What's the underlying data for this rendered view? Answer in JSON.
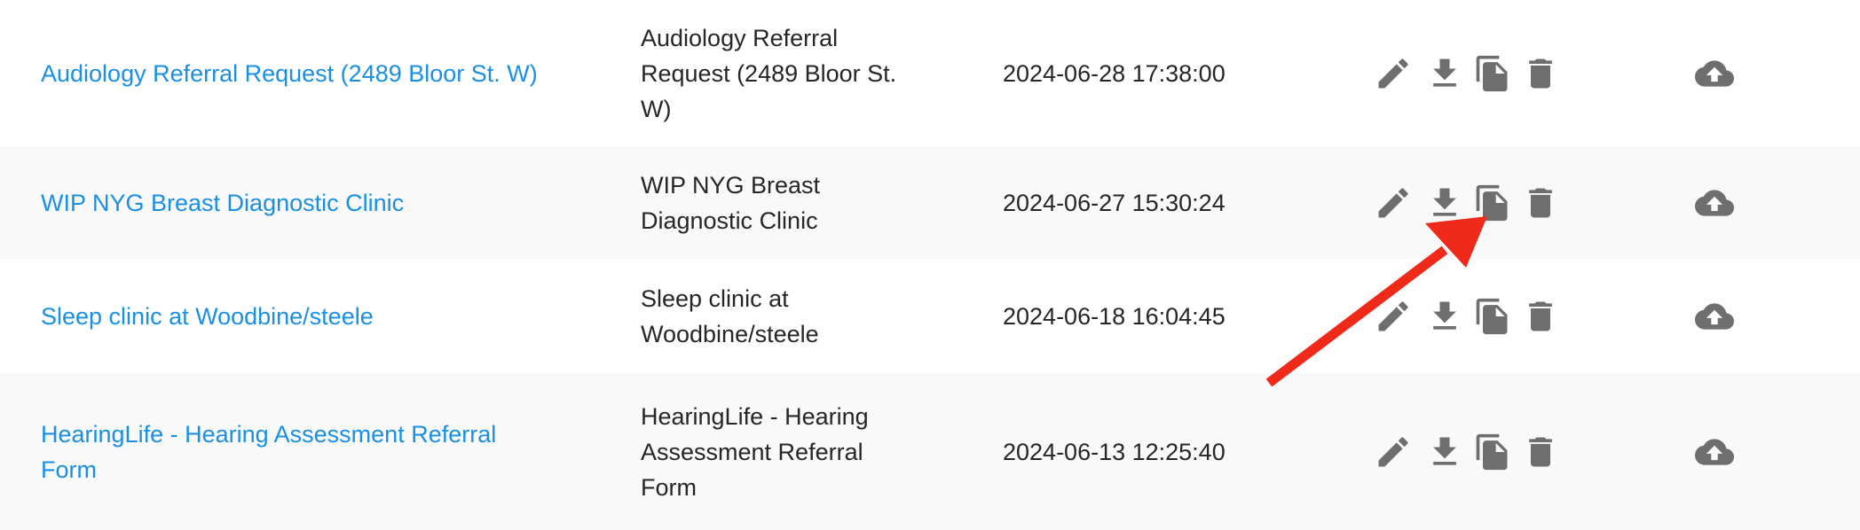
{
  "rows": [
    {
      "title": "Audiology Referral Request (2489 Bloor St. W)",
      "desc_lines": [
        "Audiology Referral",
        "Request (2489 Bloor St.",
        "W)"
      ],
      "date": "2024-06-28 17:38:00"
    },
    {
      "title": "WIP NYG Breast Diagnostic Clinic",
      "desc_lines": [
        "WIP NYG Breast",
        "Diagnostic Clinic"
      ],
      "date": "2024-06-27 15:30:24"
    },
    {
      "title": "Sleep clinic at Woodbine/steele",
      "desc_lines": [
        "Sleep clinic at",
        "Woodbine/steele"
      ],
      "date": "2024-06-18 16:04:45"
    },
    {
      "title_lines": [
        "HearingLife - Hearing Assessment Referral",
        "Form"
      ],
      "desc_lines": [
        "HearingLife - Hearing",
        "Assessment Referral",
        "Form"
      ],
      "date": "2024-06-13 12:25:40"
    }
  ],
  "icons": {
    "edit": "pencil-icon",
    "download": "download-icon",
    "copy": "copy-icon",
    "delete": "trash-icon",
    "upload": "cloud-upload-icon"
  },
  "colors": {
    "link": "#1a8fe3",
    "text": "#262626",
    "icon": "#6e6e6e",
    "row_alt": "#f9f9f9",
    "annotation_arrow": "#f02a1a"
  }
}
